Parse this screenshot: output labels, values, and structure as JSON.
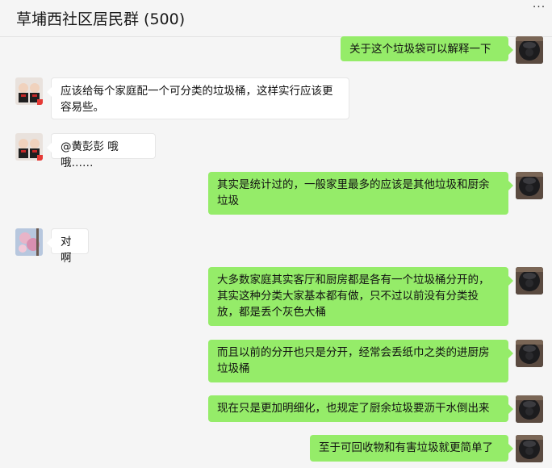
{
  "chat": {
    "title": "草埔西社区居民群 (500)",
    "more_label": "···"
  },
  "messages": [
    {
      "sender": "self",
      "avatar": "self-avatar",
      "text": "关于这个垃圾袋可以解释一下"
    },
    {
      "sender": "other",
      "avatar": "dolls-avatar",
      "text": "应该给每个家庭配一个可分类的垃圾桶，这样实行应该更容易些。"
    },
    {
      "sender": "other",
      "avatar": "dolls-avatar",
      "text": "@黄彭彭 哦哦……"
    },
    {
      "sender": "self",
      "avatar": "self-avatar",
      "text": "其实是统计过的，一般家里最多的应该是其他垃圾和厨余垃圾"
    },
    {
      "sender": "other",
      "avatar": "flower-avatar",
      "text": "对啊"
    },
    {
      "sender": "self",
      "avatar": "self-avatar",
      "text": "大多数家庭其实客厅和厨房都是各有一个垃圾桶分开的，其实这种分类大家基本都有做，只不过以前没有分类投放，都是丢个灰色大桶"
    },
    {
      "sender": "self",
      "avatar": "self-avatar",
      "text": "而且以前的分开也只是分开，经常会丢纸巾之类的进厨房垃圾桶"
    },
    {
      "sender": "self",
      "avatar": "self-avatar",
      "text": "现在只是更加明细化，也规定了厨余垃圾要沥干水倒出来"
    },
    {
      "sender": "self",
      "avatar": "self-avatar",
      "text": "至于可回收物和有害垃圾就更简单了"
    }
  ],
  "colors": {
    "self_bubble": "#95ec69",
    "other_bubble": "#ffffff",
    "background": "#f5f5f5"
  }
}
